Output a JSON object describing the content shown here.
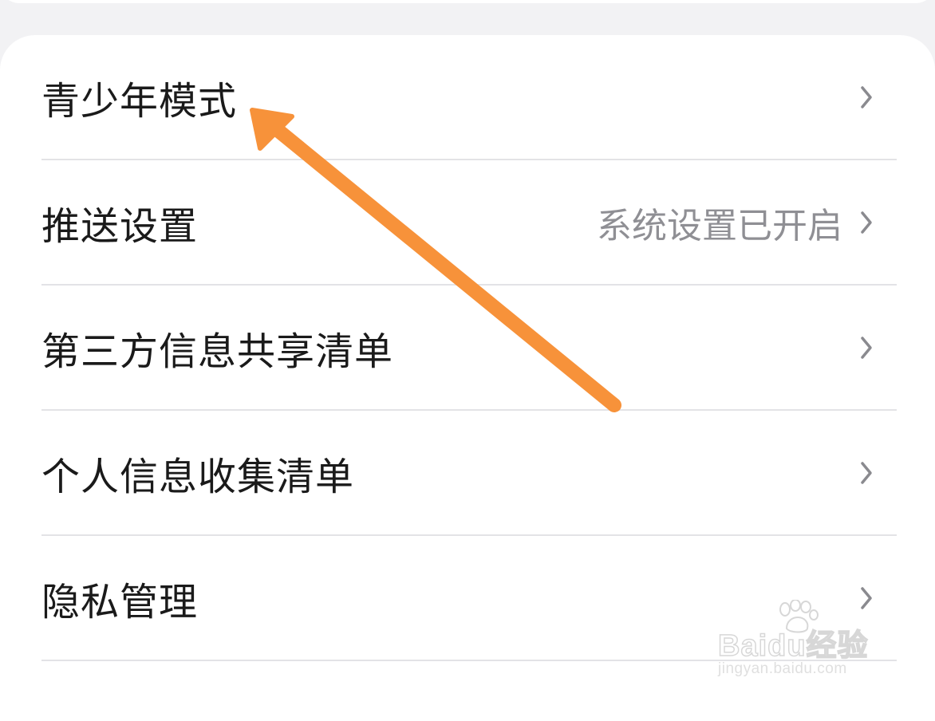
{
  "settings_list": {
    "items": [
      {
        "label": "青少年模式",
        "value": "",
        "icon": "chevron-right-icon"
      },
      {
        "label": "推送设置",
        "value": "系统设置已开启",
        "icon": "chevron-right-icon"
      },
      {
        "label": "第三方信息共享清单",
        "value": "",
        "icon": "chevron-right-icon"
      },
      {
        "label": "个人信息收集清单",
        "value": "",
        "icon": "chevron-right-icon"
      },
      {
        "label": "隐私管理",
        "value": "",
        "icon": "chevron-right-icon"
      }
    ]
  },
  "annotation": {
    "arrow_color": "#f7923a",
    "points_to": "青少年模式"
  },
  "watermark": {
    "brand": "Baidu经验",
    "url": "jingyan.baidu.com",
    "icon": "paw-icon"
  },
  "colors": {
    "background": "#f2f2f4",
    "card": "#ffffff",
    "label_text": "#1a1a1a",
    "value_text": "#8f8f94",
    "divider": "#e3e3e6",
    "chevron": "#8a8a8f"
  }
}
